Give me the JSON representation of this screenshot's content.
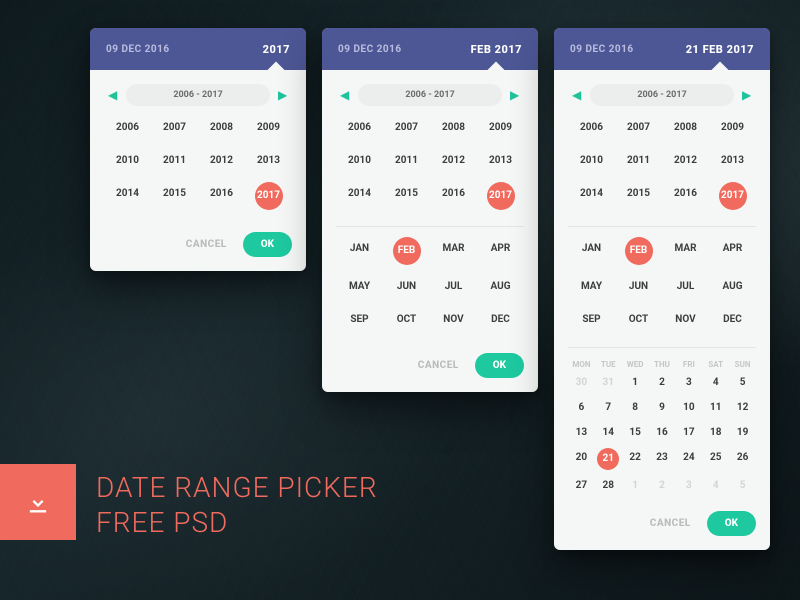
{
  "colors": {
    "header": "#4d5795",
    "accent": "#f06a5d",
    "ok": "#1ec9a0"
  },
  "promo": {
    "line1": "DATE RANGE PICKER",
    "line2": "FREE PSD"
  },
  "shared": {
    "from_date": "09 DEC 2016",
    "range_label": "2006 - 2017",
    "years": [
      "2006",
      "2007",
      "2008",
      "2009",
      "2010",
      "2011",
      "2012",
      "2013",
      "2014",
      "2015",
      "2016",
      "2017"
    ],
    "selected_year": "2017",
    "months": [
      "JAN",
      "FEB",
      "MAR",
      "APR",
      "MAY",
      "JUN",
      "JUL",
      "AUG",
      "SEP",
      "OCT",
      "NOV",
      "DEC"
    ],
    "selected_month": "FEB",
    "cancel": "CANCEL",
    "ok": "OK",
    "dow": [
      "MON",
      "TUE",
      "WED",
      "THU",
      "FRI",
      "SAT",
      "SUN"
    ]
  },
  "card1": {
    "to": "2017"
  },
  "card2": {
    "to": "FEB 2017"
  },
  "card3": {
    "to": "21 FEB 2017",
    "selected_day": 21,
    "days": [
      {
        "n": 30,
        "mute": true
      },
      {
        "n": 31,
        "mute": true
      },
      {
        "n": 1
      },
      {
        "n": 2
      },
      {
        "n": 3
      },
      {
        "n": 4
      },
      {
        "n": 5
      },
      {
        "n": 6
      },
      {
        "n": 7
      },
      {
        "n": 8
      },
      {
        "n": 9
      },
      {
        "n": 10
      },
      {
        "n": 11
      },
      {
        "n": 12
      },
      {
        "n": 13
      },
      {
        "n": 14
      },
      {
        "n": 15
      },
      {
        "n": 16
      },
      {
        "n": 17
      },
      {
        "n": 18
      },
      {
        "n": 19
      },
      {
        "n": 20
      },
      {
        "n": 21,
        "sel": true
      },
      {
        "n": 22
      },
      {
        "n": 23
      },
      {
        "n": 24
      },
      {
        "n": 25
      },
      {
        "n": 26
      },
      {
        "n": 27
      },
      {
        "n": 28
      },
      {
        "n": 1,
        "mute": true
      },
      {
        "n": 2,
        "mute": true
      },
      {
        "n": 3,
        "mute": true
      },
      {
        "n": 4,
        "mute": true
      },
      {
        "n": 5,
        "mute": true
      }
    ]
  }
}
